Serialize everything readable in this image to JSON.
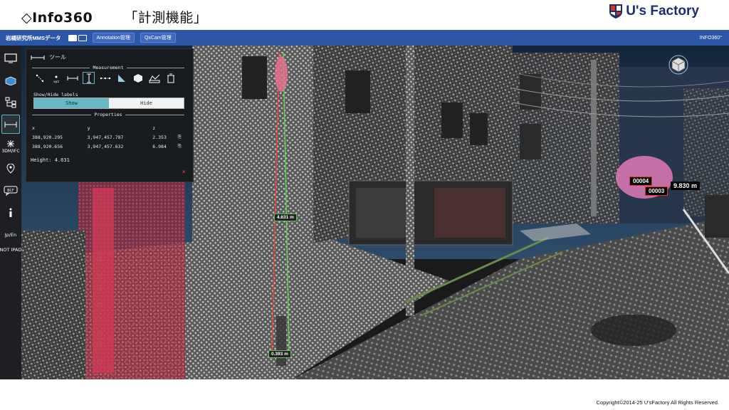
{
  "slide": {
    "title": "◇Info360",
    "subtitle": "「計測機能」",
    "brand": "U's Factory",
    "footer": "Copyright©2014-25  U'sFactory All Rights Reserved."
  },
  "appbar": {
    "project": "岩槻研究所MMSデータ",
    "annotation_btn": "Annotation管理",
    "qxcam_btn": "QxCam管理",
    "product": "INFO360°"
  },
  "toolbar": {
    "items": [
      {
        "icon": "monitor-icon"
      },
      {
        "icon": "pan-cube-icon"
      },
      {
        "icon": "tree-structure-icon"
      },
      {
        "icon": "measure-ruler-icon",
        "active": true
      },
      {
        "icon": "3dm-ifc-icon",
        "label": "3DM/IFC"
      },
      {
        "icon": "location-pin-icon"
      },
      {
        "icon": "bcf-chat-icon",
        "label": "BCF"
      },
      {
        "icon": "info-icon"
      },
      {
        "icon": "language-icon",
        "label": "Jp/En"
      }
    ],
    "not_ipad": "NOT IPAD"
  },
  "panel": {
    "title": "ツール",
    "measurement_header": "Measurement",
    "tools": [
      "point-tool-icon",
      "xyz-tool-icon",
      "distance-tool-icon",
      "height-tool-icon",
      "polyline-tool-icon",
      "area-tool-icon",
      "volume-tool-icon",
      "profile-tool-icon",
      "delete-tool-icon"
    ],
    "show_hide_label": "Show/Hide labels",
    "show": "Show",
    "hide": "Hide",
    "properties_header": "Properties",
    "columns": [
      "x",
      "y",
      "z"
    ],
    "rows": [
      {
        "x": "388,920.295",
        "y": "3,947,457.787",
        "z": "2.353"
      },
      {
        "x": "388,920.656",
        "y": "3,947,457.632",
        "z": "6.984"
      }
    ],
    "height": "Height: 4.631",
    "close": "×"
  },
  "scene": {
    "label_mid": "4.631 m",
    "label_bottom": "0.393 m",
    "tag1": "00004",
    "tag2": "00003",
    "distance": "9.830 m"
  }
}
